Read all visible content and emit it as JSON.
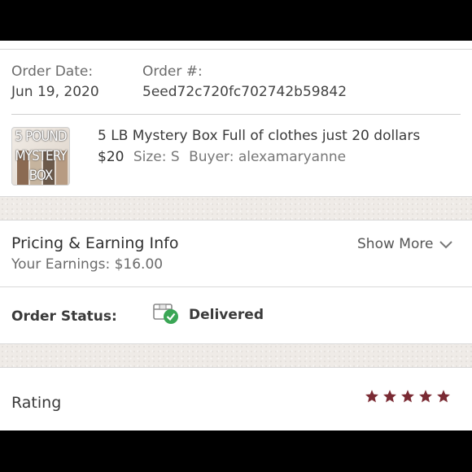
{
  "order": {
    "date_label": "Order Date:",
    "date_value": "Jun 19, 2020",
    "number_label": "Order #:",
    "number_value": "5eed72c720fc702742b59842"
  },
  "item": {
    "thumbnail_text": [
      "5 POUND",
      "MYSTERY",
      "BOX"
    ],
    "title": "5 LB Mystery Box Full of clothes just 20 dollars",
    "price": "$20",
    "size": "Size: S",
    "buyer": "Buyer: alexamaryanne"
  },
  "pricing": {
    "title": "Pricing & Earning Info",
    "earnings": "Your Earnings: $16.00",
    "show_more_label": "Show More"
  },
  "status": {
    "label": "Order Status:",
    "value": "Delivered",
    "check_color": "#3aa655"
  },
  "rating": {
    "label": "Rating",
    "stars": 5,
    "star_color": "#7a2a33"
  }
}
